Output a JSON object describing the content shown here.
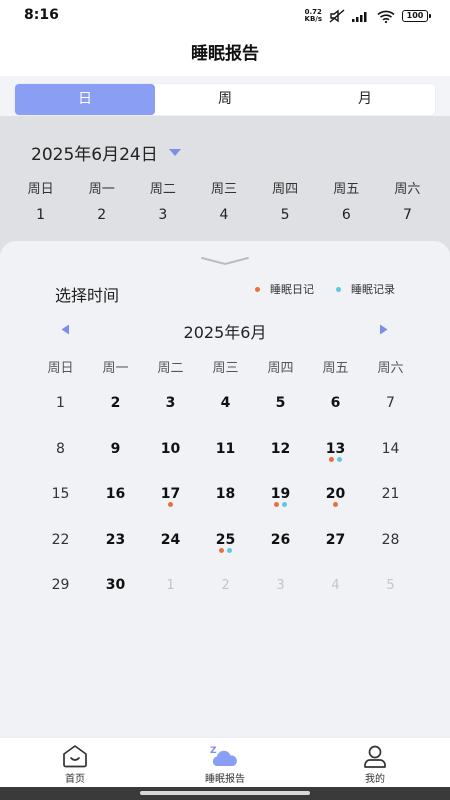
{
  "status_bar": {
    "time": "8:16",
    "net_speed": "0.72",
    "net_unit": "KB/s",
    "battery": "100"
  },
  "header": {
    "title": "睡眠报告"
  },
  "tabs": [
    {
      "label": "日",
      "active": true
    },
    {
      "label": "周",
      "active": false
    },
    {
      "label": "月",
      "active": false
    }
  ],
  "date_selector": {
    "value": "2025年6月24日"
  },
  "week_strip": {
    "weekdays": [
      "周日",
      "周一",
      "周二",
      "周三",
      "周四",
      "周五",
      "周六"
    ],
    "dates": [
      "1",
      "2",
      "3",
      "4",
      "5",
      "6",
      "7"
    ]
  },
  "picker": {
    "title": "选择时间",
    "legend": {
      "sleep_diary": "睡眠日记",
      "sleep_record": "睡眠记录"
    },
    "month_title": "2025年6月",
    "weekdays": [
      "周日",
      "周一",
      "周二",
      "周三",
      "周四",
      "周五",
      "周六"
    ],
    "weeks": [
      [
        {
          "d": "1",
          "bold": false
        },
        {
          "d": "2",
          "bold": true
        },
        {
          "d": "3",
          "bold": true
        },
        {
          "d": "4",
          "bold": true
        },
        {
          "d": "5",
          "bold": true
        },
        {
          "d": "6",
          "bold": true
        },
        {
          "d": "7",
          "bold": false
        }
      ],
      [
        {
          "d": "8",
          "bold": false
        },
        {
          "d": "9",
          "bold": true
        },
        {
          "d": "10",
          "bold": true
        },
        {
          "d": "11",
          "bold": true
        },
        {
          "d": "12",
          "bold": true
        },
        {
          "d": "13",
          "bold": true,
          "diary": true,
          "record": true
        },
        {
          "d": "14",
          "bold": false
        }
      ],
      [
        {
          "d": "15",
          "bold": false
        },
        {
          "d": "16",
          "bold": true
        },
        {
          "d": "17",
          "bold": true,
          "diary": true
        },
        {
          "d": "18",
          "bold": true
        },
        {
          "d": "19",
          "bold": true,
          "diary": true,
          "record": true
        },
        {
          "d": "20",
          "bold": true,
          "diary": true
        },
        {
          "d": "21",
          "bold": false
        }
      ],
      [
        {
          "d": "22",
          "bold": false
        },
        {
          "d": "23",
          "bold": true
        },
        {
          "d": "24",
          "bold": true
        },
        {
          "d": "25",
          "bold": true,
          "diary": true,
          "record": true
        },
        {
          "d": "26",
          "bold": true
        },
        {
          "d": "27",
          "bold": true
        },
        {
          "d": "28",
          "bold": false
        }
      ],
      [
        {
          "d": "29",
          "bold": false
        },
        {
          "d": "30",
          "bold": true
        },
        {
          "d": "1",
          "next": true
        },
        {
          "d": "2",
          "next": true
        },
        {
          "d": "3",
          "next": true
        },
        {
          "d": "4",
          "next": true
        },
        {
          "d": "5",
          "next": true
        }
      ]
    ]
  },
  "bottom_nav": [
    {
      "label": "首页",
      "icon": "home-icon",
      "active": false
    },
    {
      "label": "睡眠报告",
      "icon": "sleep-cloud-icon",
      "active": true
    },
    {
      "label": "我的",
      "icon": "user-icon",
      "active": false
    }
  ],
  "colors": {
    "accent": "#8a9ef4",
    "diary_dot": "#e8703f",
    "record_dot": "#5ec6e6"
  }
}
